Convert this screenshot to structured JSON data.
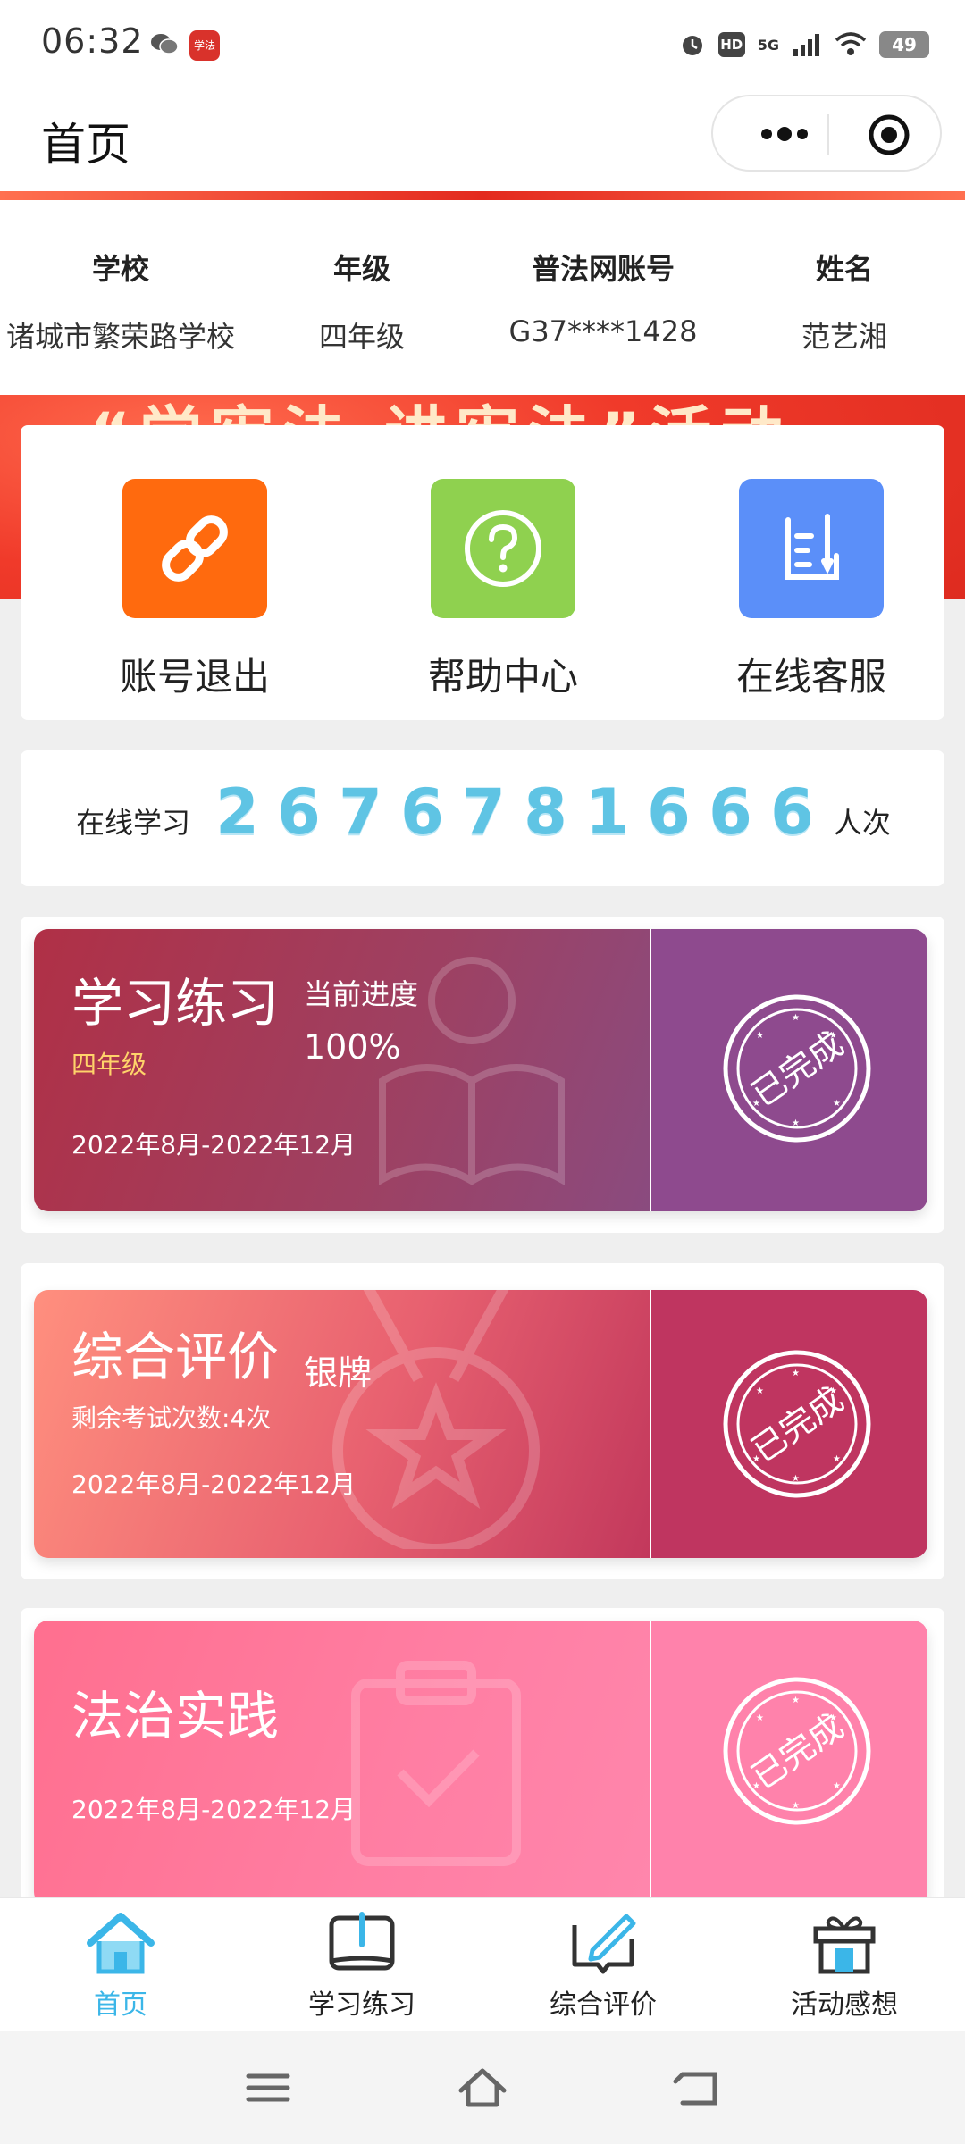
{
  "status_bar": {
    "time": "06:32",
    "app_badge": "学法",
    "hd": "HD",
    "network": "5G",
    "battery": "49"
  },
  "navbar": {
    "title": "首页"
  },
  "banner": {
    "slogan": "“学宪法 讲宪法”活动"
  },
  "info": {
    "columns": [
      {
        "head": "学校",
        "value": "诸城市繁荣路学校"
      },
      {
        "head": "年级",
        "value": "四年级"
      },
      {
        "head": "普法网账号",
        "value": "G37****1428"
      },
      {
        "head": "姓名",
        "value": "范艺湘"
      }
    ]
  },
  "actions": [
    {
      "label": "账号退出",
      "icon": "link-icon",
      "color": "#ff6a0e"
    },
    {
      "label": "帮助中心",
      "icon": "question-icon",
      "color": "#8fd14f"
    },
    {
      "label": "在线客服",
      "icon": "note-pen-icon",
      "color": "#5b8ff9"
    }
  ],
  "counter": {
    "prefix": "在线学习",
    "digits": [
      "2",
      "6",
      "7",
      "6",
      "7",
      "8",
      "1",
      "6",
      "6",
      "6"
    ],
    "suffix": "人次"
  },
  "modules": [
    {
      "title": "学习练习",
      "progress_label": "当前进度",
      "progress_value": "100%",
      "grade": "四年级",
      "date_range": "2022年8月-2022年12月",
      "stamp_text": "已完成"
    },
    {
      "title": "综合评价",
      "medal": "银牌",
      "remaining": "剩余考试次数:4次",
      "date_range": "2022年8月-2022年12月",
      "stamp_text": "已完成"
    },
    {
      "title": "法治实践",
      "date_range": "2022年8月-2022年12月",
      "stamp_text": "已完成"
    }
  ],
  "tabbar": [
    {
      "label": "首页",
      "icon": "home-icon",
      "active": true
    },
    {
      "label": "学习练习",
      "icon": "book-icon",
      "active": false
    },
    {
      "label": "综合评价",
      "icon": "edit-icon",
      "active": false
    },
    {
      "label": "活动感想",
      "icon": "gift-icon",
      "active": false
    }
  ],
  "colors": {
    "accent": "#3bb6e8",
    "module1_left": "#b23a4e",
    "module1_right": "#8e4a8e",
    "module2_left": "#f97a6e",
    "module2_right": "#bf3560",
    "module3": "#ff7fa6"
  }
}
